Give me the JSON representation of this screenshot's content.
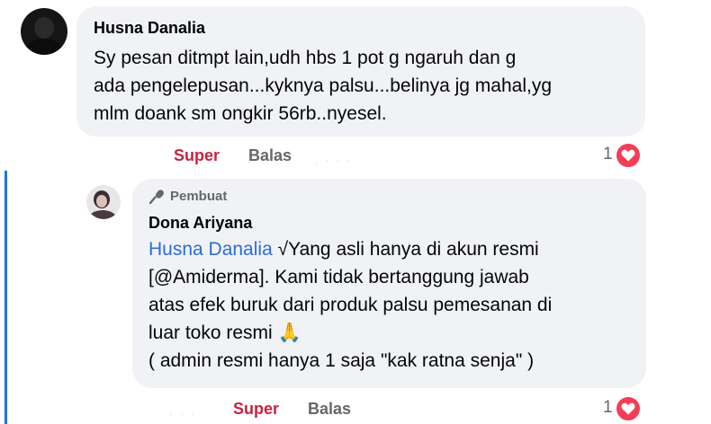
{
  "comments": [
    {
      "author": "Husna Danalia",
      "text": "Sy pesan ditmpt lain,udh hbs 1 pot g ngaruh dan g\nada pengelepusan...kyknya palsu...belinya jg mahal,yg\nmlm doank sm ongkir 56rb..nyesel.",
      "reaction_label": "Super",
      "reply_label": "Balas",
      "reaction_count": "1",
      "reaction_icon": "heart-icon"
    },
    {
      "badge_label": "Pembuat",
      "author": "Dona Ariyana",
      "mention": "Husna Danalia",
      "text": " √Yang asli hanya di akun resmi\n[@Amiderma]. Kami tidak bertanggung jawab\natas efek buruk dari produk palsu pemesanan di\nluar toko resmi 🙏\n( admin resmi hanya 1 saja \"kak ratna senja\" )",
      "reaction_label": "Super",
      "reply_label": "Balas",
      "reaction_count": "1",
      "reaction_icon": "heart-icon"
    }
  ],
  "colors": {
    "bubble": "#f0f2f5",
    "super": "#c9223f",
    "mention": "#2d6cd6",
    "heart": "#f33e58",
    "thread_line": "#1b74e4"
  }
}
